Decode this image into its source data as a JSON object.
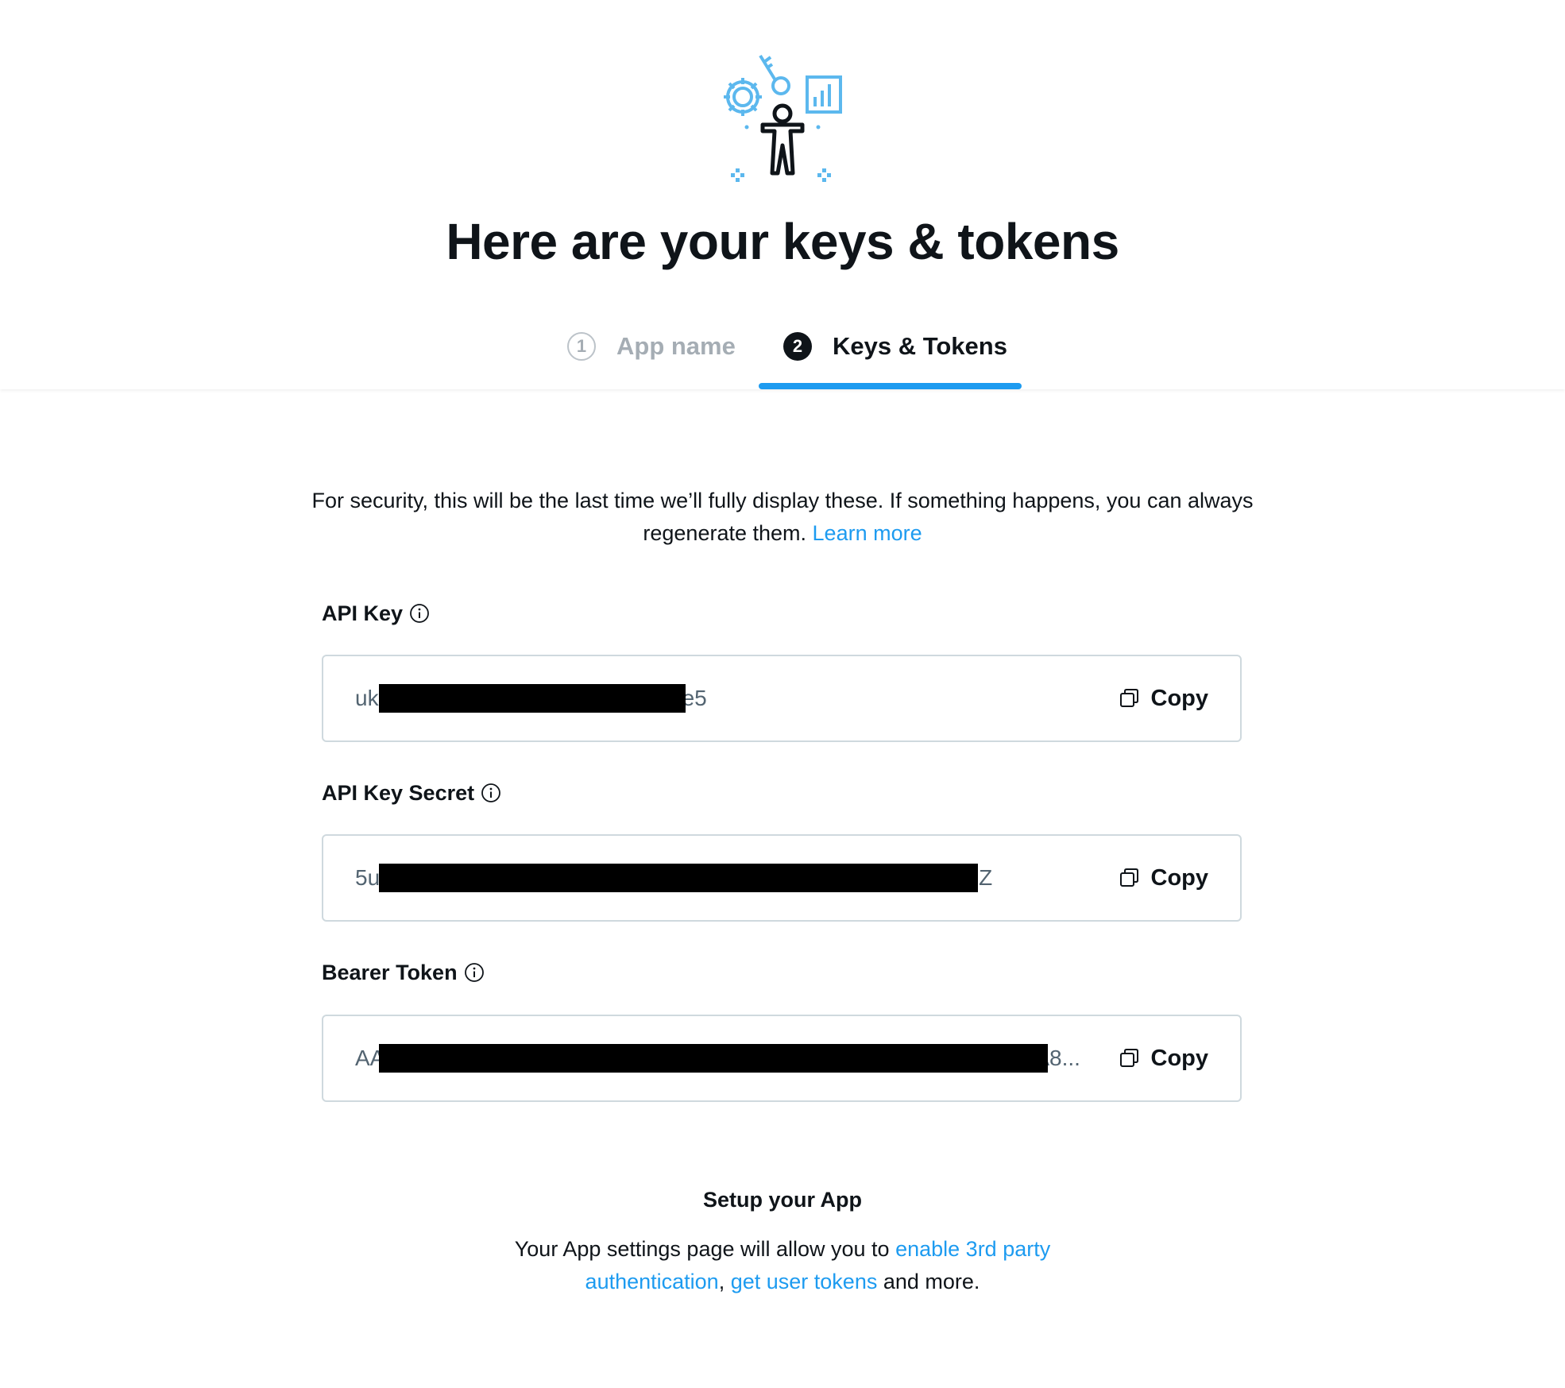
{
  "header": {
    "title": "Here are your keys & tokens",
    "steps": [
      {
        "number": "1",
        "label": "App name",
        "state": "completed"
      },
      {
        "number": "2",
        "label": "Keys & Tokens",
        "state": "active"
      }
    ]
  },
  "notice": {
    "text": "For security, this will be the last time we’ll fully display these. If something happens, you can always regenerate them.",
    "link": "Learn more"
  },
  "fields": [
    {
      "label": "API Key",
      "value_start": "uk",
      "value_end": "e5",
      "copy_label": "Copy"
    },
    {
      "label": "API Key Secret",
      "value_start": "5u",
      "value_end": "Z",
      "copy_label": "Copy"
    },
    {
      "label": "Bearer Token",
      "value_start": "AA",
      "value_end": "A8...",
      "copy_label": "Copy"
    }
  ],
  "setup": {
    "title": "Setup your App",
    "text_before": "Your App settings page will allow you to",
    "link1": "enable 3rd party authentication",
    "separator": ",",
    "link2": "get user tokens",
    "text_after": "and more."
  },
  "colors": {
    "accent": "#1d9bf0",
    "text": "#0f1419",
    "muted": "#536471",
    "border": "#cfd9de",
    "inactive_step": "#a5adb4"
  },
  "icons": {
    "hero": "developer-illustration-icon",
    "info": "info-icon",
    "copy": "copy-icon"
  }
}
